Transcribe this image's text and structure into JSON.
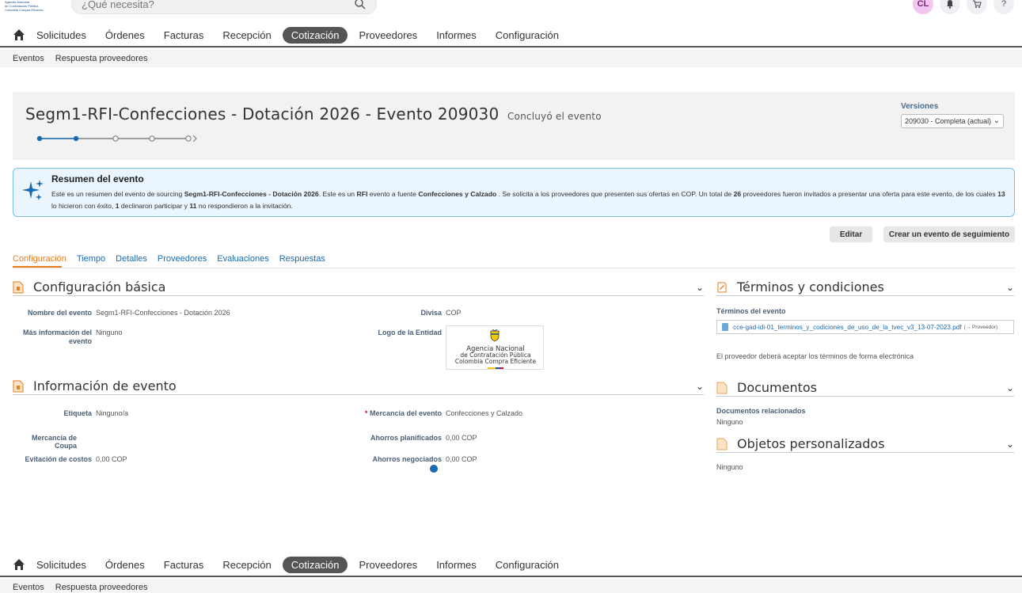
{
  "topbar": {
    "logo_lines": [
      "Agencia Nacional",
      "de Contratación Pública",
      "Colombia Compra Eficiente"
    ],
    "search_placeholder": "¿Qué necesita?",
    "user_initials": "CL",
    "icons": [
      "bell-icon",
      "cart-icon",
      "help-icon"
    ]
  },
  "nav": {
    "items": [
      "Solicitudes",
      "Órdenes",
      "Facturas",
      "Recepción",
      "Cotización",
      "Proveedores",
      "Informes",
      "Configuración"
    ],
    "active": "Cotización"
  },
  "subnav": {
    "items": [
      "Eventos",
      "Respuesta proveedores"
    ]
  },
  "event": {
    "title": "Segm1-RFI-Confecciones - Dotación 2026 - Evento 209030",
    "status": "Concluyó el evento"
  },
  "versions": {
    "label": "Versiones",
    "selected": "209030 - Completa (actual)"
  },
  "summary": {
    "title": "Resumen del evento",
    "text_1": "Este es un resumen del evento de sourcing ",
    "event_name": "Segm1-RFI-Confecciones - Dotación 2026",
    "text_2": ". Este es un ",
    "event_type": "RFI",
    "text_3": " evento a fuente ",
    "commodity": "Confecciones y Calzado",
    "text_4": " . Se solicita a los proveedores que presenten sus ofertas en COP. Un total de ",
    "invited": "26",
    "text_5": " proveedores fueron invitados a presentar una oferta para este evento, de los cuales ",
    "successful": "13",
    "text_6": " lo hicieron con éxito, ",
    "declined": "1",
    "text_7": " declinaron participar y ",
    "no_response": "11",
    "text_8": " no respondieron a la invitación."
  },
  "actions": {
    "edit": "Editar",
    "follow_up": "Crear un evento de seguimiento"
  },
  "tabs": [
    "Configuración",
    "Tiempo",
    "Detalles",
    "Proveedores",
    "Evaluaciones",
    "Respuestas"
  ],
  "basic_config": {
    "title": "Configuración básica",
    "event_name_label": "Nombre del evento",
    "event_name_value": "Segm1-RFI-Confecciones - Dotación 2026",
    "more_info_label": "Más información del evento",
    "more_info_value": "Ninguno",
    "currency_label": "Divisa",
    "currency_value": "COP",
    "entity_logo_label": "Logo de la Entidad",
    "entity_logo_text": [
      "Agencia Nacional",
      "de Contratación Pública",
      "Colombia Compra Eficiente"
    ]
  },
  "event_info": {
    "title": "Información de evento",
    "tag_label": "Etiqueta",
    "tag_value": "Ninguno/a",
    "coupa_commodity_label": "Mercancía de Coupa",
    "cost_avoidance_label": "Evitación de costos",
    "cost_avoidance_value": "0,00 COP",
    "required_mark": "*",
    "event_commodity_label": "Mercancía del evento",
    "event_commodity_value": "Confecciones y Calzado",
    "planned_savings_label": "Ahorros planificados",
    "planned_savings_value": "0,00 COP",
    "negotiated_savings_label": "Ahorros negociados",
    "negotiated_savings_value": "0,00 COP"
  },
  "terms": {
    "title": "Términos y condiciones",
    "event_terms_label": "Términos del evento",
    "file_name": "cce-gad-idi-01_terminos_y_codiciones_de_uso_de_la_tvec_v3_13-07-2023.pdf",
    "file_target": "(→ Proveedor)",
    "note": "El proveedor deberá aceptar los términos de forma electrónica"
  },
  "documents": {
    "title": "Documentos",
    "related_label": "Documentos relacionados",
    "related_value": "Ninguno"
  },
  "custom_objects": {
    "title": "Objetos personalizados",
    "value": "Ninguno"
  },
  "colors": {
    "accent": "#e67e22",
    "link": "#1a6ab0",
    "summary_bg": "#eaf5fd",
    "summary_border": "#7cc0ea",
    "nav_active": "#555555"
  }
}
